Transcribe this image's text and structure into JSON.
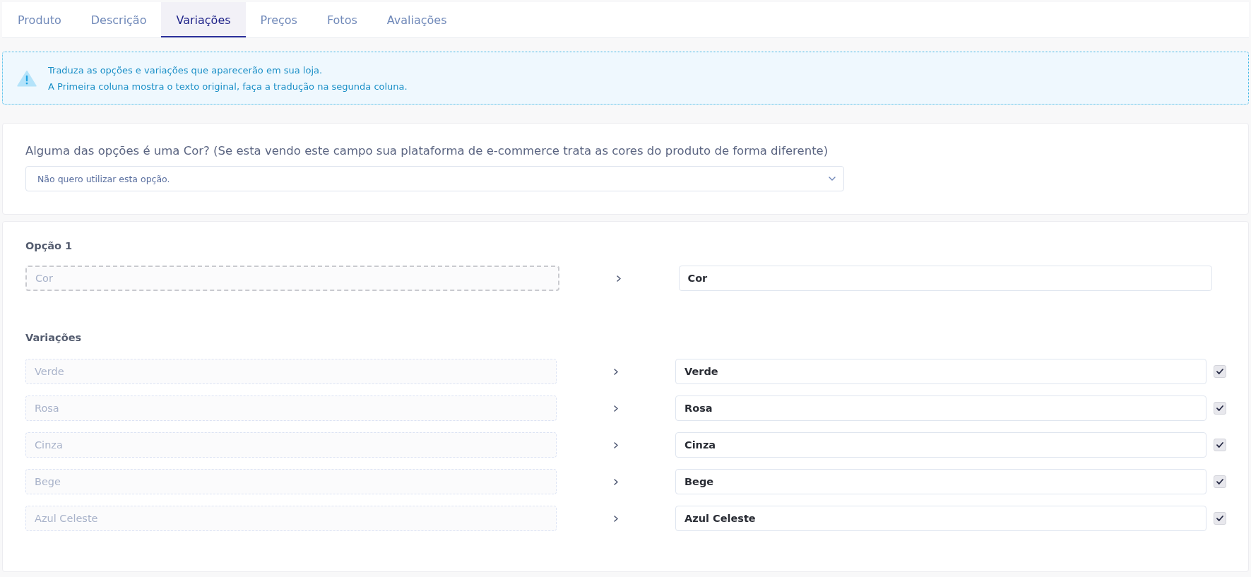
{
  "tabs": [
    {
      "label": "Produto",
      "selected": false
    },
    {
      "label": "Descrição",
      "selected": false
    },
    {
      "label": "Variações",
      "selected": true
    },
    {
      "label": "Preços",
      "selected": false
    },
    {
      "label": "Fotos",
      "selected": false
    },
    {
      "label": "Avaliações",
      "selected": false
    }
  ],
  "alert": {
    "lines": [
      "Traduza as opções e variações que aparecerão em sua loja.",
      "A Primeira coluna mostra o texto original, faça a tradução na segunda coluna."
    ]
  },
  "color_option": {
    "label": "Alguma das opções é uma Cor? (Se esta vendo este campo sua plataforma de e-commerce trata as cores do produto de forma diferente)",
    "value": "Não quero utilizar esta opção."
  },
  "options": [
    {
      "label": "Opção 1",
      "original": "Cor",
      "translation": "Cor",
      "variations_label": "Variações",
      "variations": [
        {
          "original": "Verde",
          "translation": "Verde",
          "checked": true
        },
        {
          "original": "Rosa",
          "translation": "Rosa",
          "checked": true
        },
        {
          "original": "Cinza",
          "translation": "Cinza",
          "checked": true
        },
        {
          "original": "Bege",
          "translation": "Bege",
          "checked": true
        },
        {
          "original": "Azul Celeste",
          "translation": "Azul Celeste",
          "checked": true
        }
      ]
    }
  ]
}
